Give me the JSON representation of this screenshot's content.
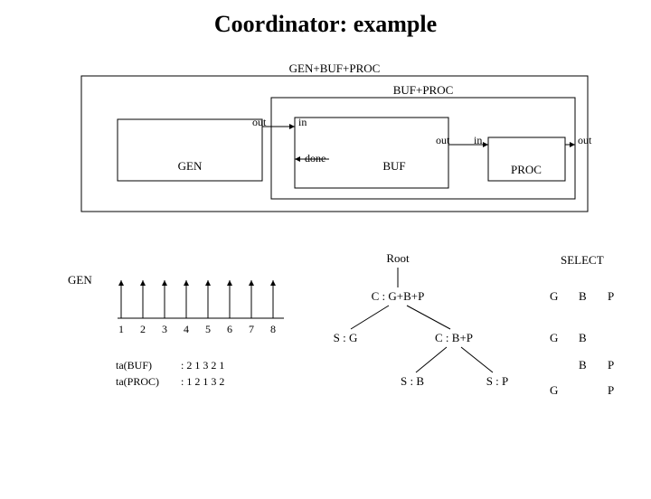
{
  "title": "Coordinator: example",
  "labels": {
    "outer": "GEN+BUF+PROC",
    "inner": "BUF+PROC",
    "gen": "GEN",
    "buf": "BUF",
    "proc": "PROC",
    "out": "out",
    "in": "in",
    "done": "done"
  },
  "timeline": {
    "name": "GEN",
    "ticks": [
      "1",
      "2",
      "3",
      "4",
      "5",
      "6",
      "7",
      "8"
    ],
    "ta": [
      {
        "name": "ta(BUF)",
        "vals": ": 2 1 3 2 1"
      },
      {
        "name": "ta(PROC)",
        "vals": ": 1 2 1 3 2"
      }
    ]
  },
  "tree": {
    "root": "Root",
    "select": "SELECT",
    "cgbp": "C : G+B+P",
    "sg": "S : G",
    "cbp": "C : B+P",
    "sb": "S : B",
    "sp": "S : P",
    "g": "G",
    "b": "B",
    "p": "P"
  },
  "chart_data": {
    "type": "table",
    "title": "ta sequences",
    "series": [
      {
        "name": "ta(BUF)",
        "values": [
          2,
          1,
          3,
          2,
          1
        ]
      },
      {
        "name": "ta(PROC)",
        "values": [
          1,
          2,
          1,
          3,
          2
        ]
      }
    ],
    "timeline_ticks": [
      1,
      2,
      3,
      4,
      5,
      6,
      7,
      8
    ]
  }
}
